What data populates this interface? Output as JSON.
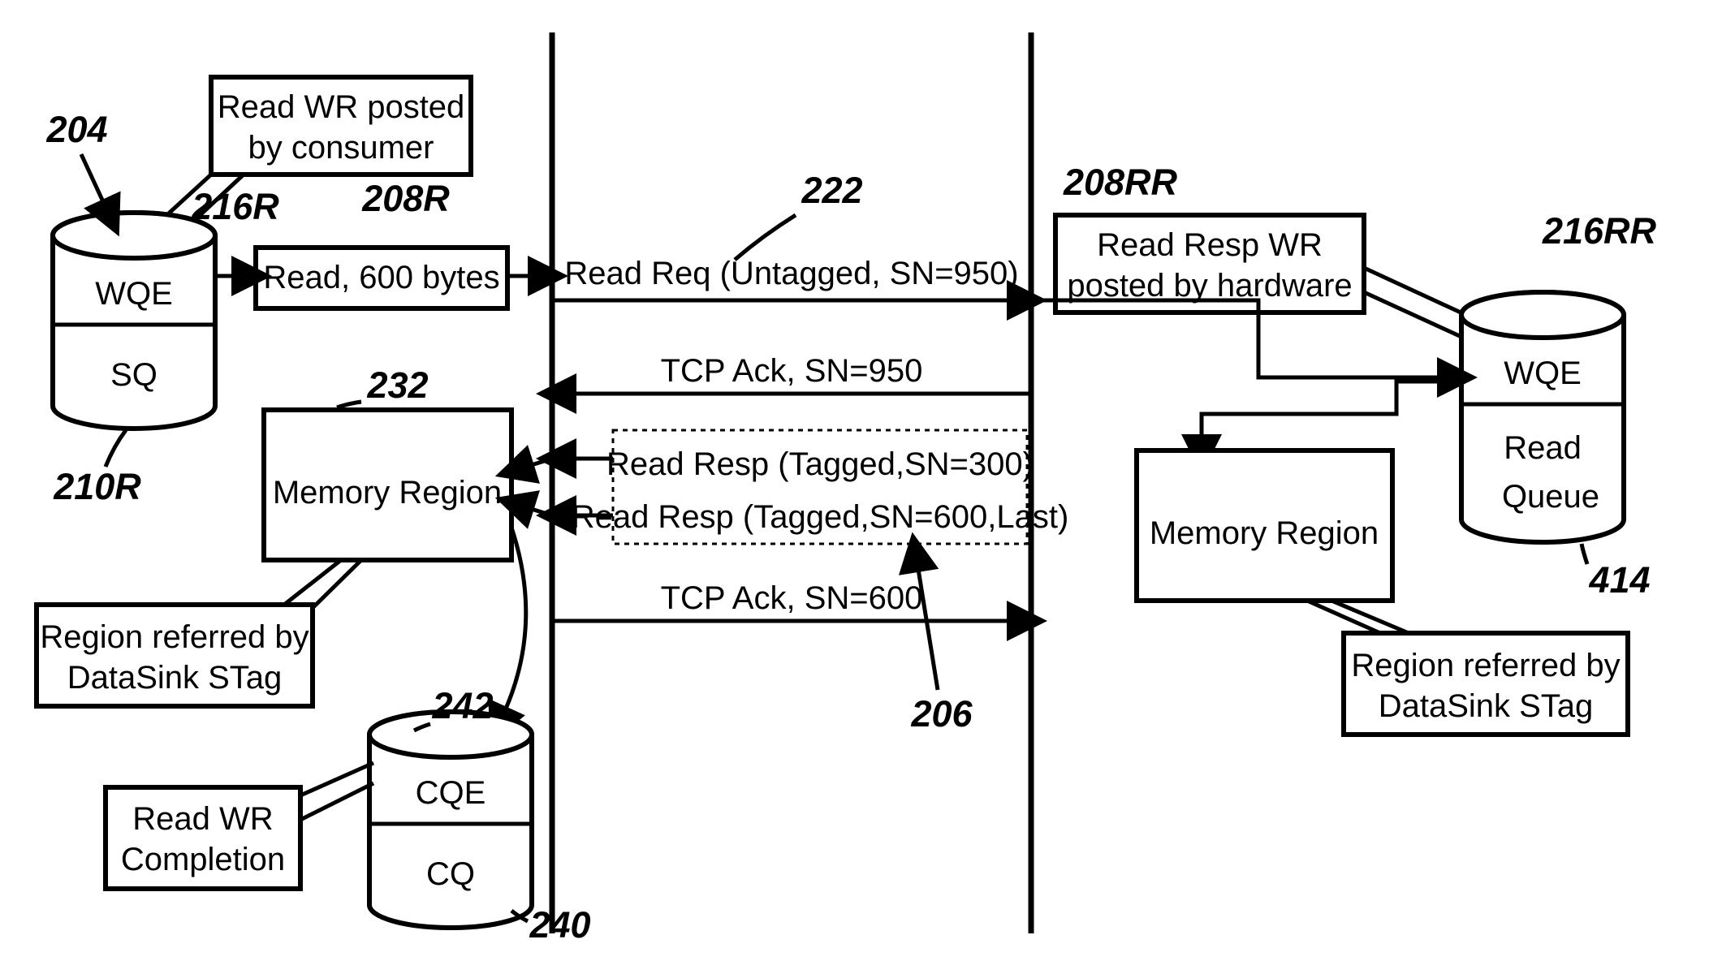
{
  "refs": {
    "r204": "204",
    "r216R": "216R",
    "r208R": "208R",
    "r222": "222",
    "r208RR": "208RR",
    "r216RR": "216RR",
    "r210R": "210R",
    "r232": "232",
    "r414": "414",
    "r242": "242",
    "r206": "206",
    "r240": "240"
  },
  "labels": {
    "readWR1": "Read WR posted",
    "readWR2": "by consumer",
    "wqe": "WQE",
    "sq": "SQ",
    "read600": "Read, 600 bytes",
    "readReq": "Read Req (Untagged, SN=950)",
    "tcpAck950": "TCP Ack, SN=950",
    "readResp300": "Read Resp (Tagged,SN=300)",
    "readResp600": "Read Resp (Tagged,SN=600,Last)",
    "tcpAck600": "TCP Ack, SN=600",
    "readRespWR1": "Read Resp WR",
    "readRespWR2": "posted by hardware",
    "wqe2": "WQE",
    "readQ1": "Read",
    "readQ2": "Queue",
    "memRegion": "Memory Region",
    "regionRef1": "Region referred by",
    "regionRef2": "DataSink STag",
    "regionRefR1": "Region referred by",
    "regionRefR2": "DataSink STag",
    "cqe": "CQE",
    "cq": "CQ",
    "readWRcomp1": "Read WR",
    "readWRcomp2": "Completion"
  }
}
